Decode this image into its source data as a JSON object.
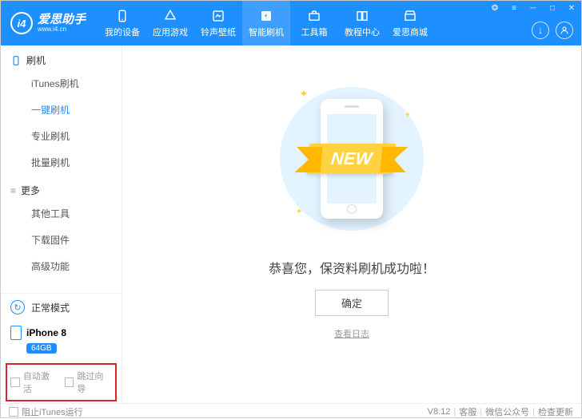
{
  "logo": {
    "badge": "i4",
    "cn": "爱思助手",
    "url": "www.i4.cn"
  },
  "tabs": [
    {
      "name": "my-device",
      "label": "我的设备"
    },
    {
      "name": "app-games",
      "label": "应用游戏"
    },
    {
      "name": "ring-wall",
      "label": "铃声壁纸"
    },
    {
      "name": "smart-flash",
      "label": "智能刷机"
    },
    {
      "name": "toolbox",
      "label": "工具箱"
    },
    {
      "name": "tutorial",
      "label": "教程中心"
    },
    {
      "name": "store",
      "label": "爱思商城"
    }
  ],
  "sidebar": {
    "group1": "刷机",
    "items1": [
      "iTunes刷机",
      "一键刷机",
      "专业刷机",
      "批量刷机"
    ],
    "group2": "更多",
    "items2": [
      "其他工具",
      "下载固件",
      "高级功能"
    ],
    "mode": "正常模式",
    "device": "iPhone 8",
    "storage": "64GB",
    "chk1": "自动激活",
    "chk2": "跳过向导"
  },
  "main": {
    "ribbon": "NEW",
    "message": "恭喜您，保资料刷机成功啦！",
    "ok": "确定",
    "log": "查看日志"
  },
  "footer": {
    "block_itunes": "阻止iTunes运行",
    "version": "V8.12",
    "svc": "客服",
    "wechat": "微信公众号",
    "update": "检查更新"
  }
}
